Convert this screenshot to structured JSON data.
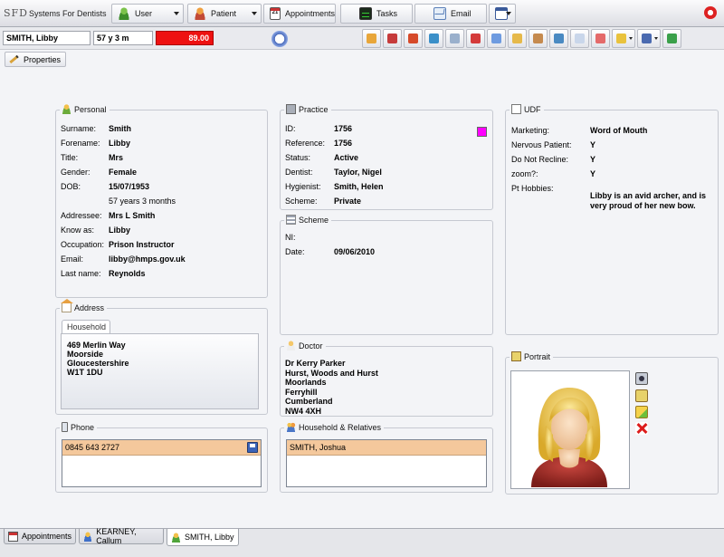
{
  "app": {
    "logo": "SFD",
    "title": "Systems For Dentists"
  },
  "menu": {
    "user": "User",
    "patient": "Patient",
    "appointments": "Appointments",
    "tasks": "Tasks",
    "email": "Email",
    "appointments_icon_day": "21"
  },
  "patient_bar": {
    "name": "SMITH, Libby",
    "age": "57 y 3 m",
    "balance": "89.00",
    "balance_color": "#ee1111"
  },
  "toolbar_icons": [
    "home-icon",
    "calendar-icon",
    "xray-icon",
    "treatment-icon",
    "notes-icon",
    "medical-icon",
    "attach-icon",
    "scales-icon",
    "chart-icon",
    "photo-icon",
    "card-icon",
    "mouth-icon",
    "pen-icon",
    "window-icon",
    "add-calendar-icon"
  ],
  "properties_button": "Properties",
  "personal": {
    "title": "Personal",
    "fields": [
      {
        "label": "Surname:",
        "value": "Smith"
      },
      {
        "label": "Forename:",
        "value": "Libby"
      },
      {
        "label": "Title:",
        "value": "Mrs"
      },
      {
        "label": "Gender:",
        "value": "Female"
      },
      {
        "label": "DOB:",
        "value": "15/07/1953"
      },
      {
        "label": "",
        "value": "57 years 3 months"
      },
      {
        "label": "Addressee:",
        "value": "Mrs L Smith"
      },
      {
        "label": "Know as:",
        "value": "Libby"
      },
      {
        "label": "Occupation:",
        "value": "Prison Instructor"
      },
      {
        "label": "Email:",
        "value": "libby@hmps.gov.uk"
      },
      {
        "label": "Last name:",
        "value": "Reynolds"
      }
    ]
  },
  "practice": {
    "title": "Practice",
    "swatch_color": "#ff00ff",
    "fields": [
      {
        "label": "ID:",
        "value": "1756"
      },
      {
        "label": "Reference:",
        "value": "1756"
      },
      {
        "label": "Status:",
        "value": "Active"
      },
      {
        "label": "Dentist:",
        "value": "Taylor, Nigel"
      },
      {
        "label": "Hygienist:",
        "value": "Smith, Helen"
      },
      {
        "label": "Scheme:",
        "value": "Private"
      }
    ]
  },
  "scheme": {
    "title": "Scheme",
    "fields": [
      {
        "label": "NI:",
        "value": ""
      },
      {
        "label": "Date:",
        "value": "09/06/2010"
      }
    ]
  },
  "address": {
    "title": "Address",
    "tab": "Household",
    "lines": [
      "469 Merlin Way",
      "Moorside",
      "Gloucestershire",
      "W1T 1DU"
    ]
  },
  "doctor": {
    "title": "Doctor",
    "lines": [
      "Dr Kerry Parker",
      "Hurst, Woods and Hurst",
      "Moorlands",
      "Ferryhill",
      "Cumberland",
      "NW4 4XH"
    ]
  },
  "phone": {
    "title": "Phone",
    "number": "0845 643 2727"
  },
  "household": {
    "title": "Household & Relatives",
    "members": [
      "SMITH, Joshua"
    ]
  },
  "udf": {
    "title": "UDF",
    "fields": [
      {
        "label": "Marketing:",
        "value": "Word of Mouth"
      },
      {
        "label": "Nervous Patient:",
        "value": "Y"
      },
      {
        "label": "Do Not Recline:",
        "value": "Y"
      },
      {
        "label": "zoom?:",
        "value": "Y"
      },
      {
        "label": "Pt Hobbies:",
        "value": "Libby is an avid archer, and is very proud of her new bow."
      }
    ]
  },
  "portrait": {
    "title": "Portrait"
  },
  "bottom_tabs": [
    {
      "label": "Appointments",
      "active": false
    },
    {
      "label": "KEARNEY, Callum",
      "active": false
    },
    {
      "label": "SMITH, Libby",
      "active": true
    }
  ]
}
